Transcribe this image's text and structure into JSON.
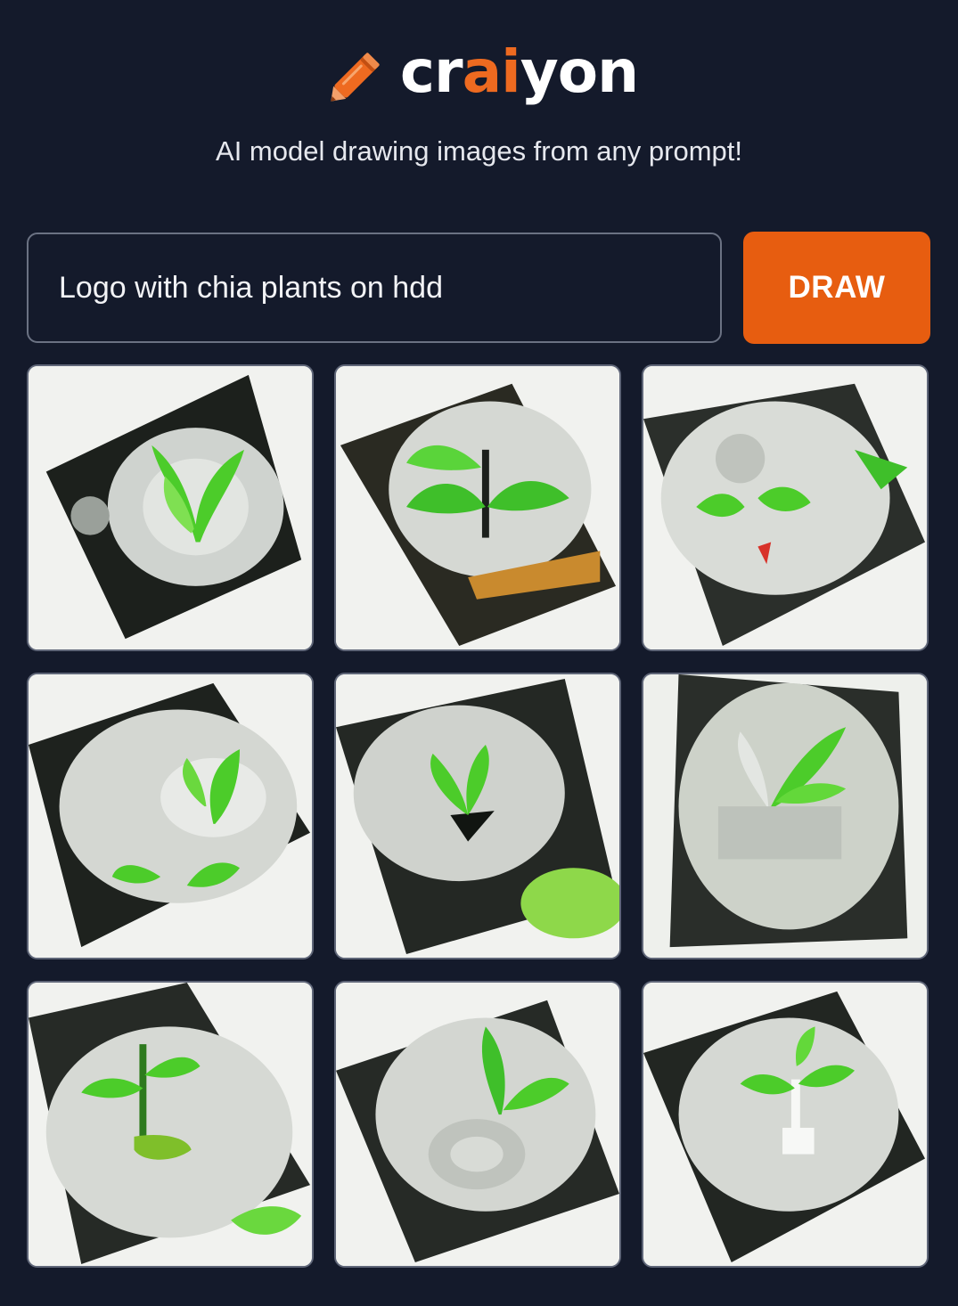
{
  "brand": {
    "name_prefix": "cr",
    "name_accent": "ai",
    "name_suffix": "yon",
    "accent_color": "#ee6a20",
    "logo_icon": "pencil-icon"
  },
  "tagline": "AI model drawing images from any prompt!",
  "prompt": {
    "value": "Logo with chia plants on hdd"
  },
  "draw_button": {
    "label": "DRAW",
    "color": "#e75d10"
  },
  "results": {
    "count": 9,
    "subject": "hard drive platter with green sprouting plant",
    "plant_color": "#4ccc2a"
  },
  "colors": {
    "background": "#141a2b",
    "tile_border": "#5f6678"
  }
}
